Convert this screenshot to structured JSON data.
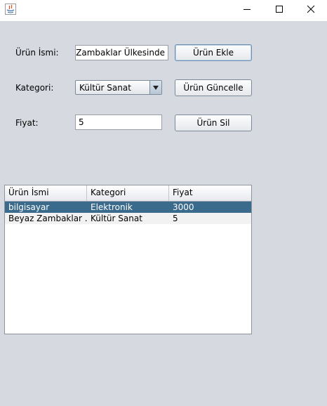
{
  "window": {
    "minimize_icon": "minimize-icon",
    "maximize_icon": "maximize-icon",
    "close_icon": "close-icon"
  },
  "form": {
    "name_label": "Ürün İsmi:",
    "name_value": "Beyaz Zambaklar Ülkesinde",
    "category_label": "Kategori:",
    "category_selected": "Kültür Sanat",
    "price_label": "Fiyat:",
    "price_value": "5"
  },
  "buttons": {
    "add": "Ürün Ekle",
    "update": "Ürün Güncelle",
    "delete": "Ürün Sil"
  },
  "table": {
    "columns": [
      "Ürün İsmi",
      "Kategori",
      "Fiyat"
    ],
    "rows": [
      [
        "bilgisayar",
        "Elektronik",
        "3000"
      ],
      [
        "Beyaz Zambaklar ...",
        "Kültür Sanat",
        "5"
      ]
    ],
    "selected_row": 0
  },
  "colors": {
    "background": "#d6d9df",
    "selection": "#3a6a8c"
  }
}
